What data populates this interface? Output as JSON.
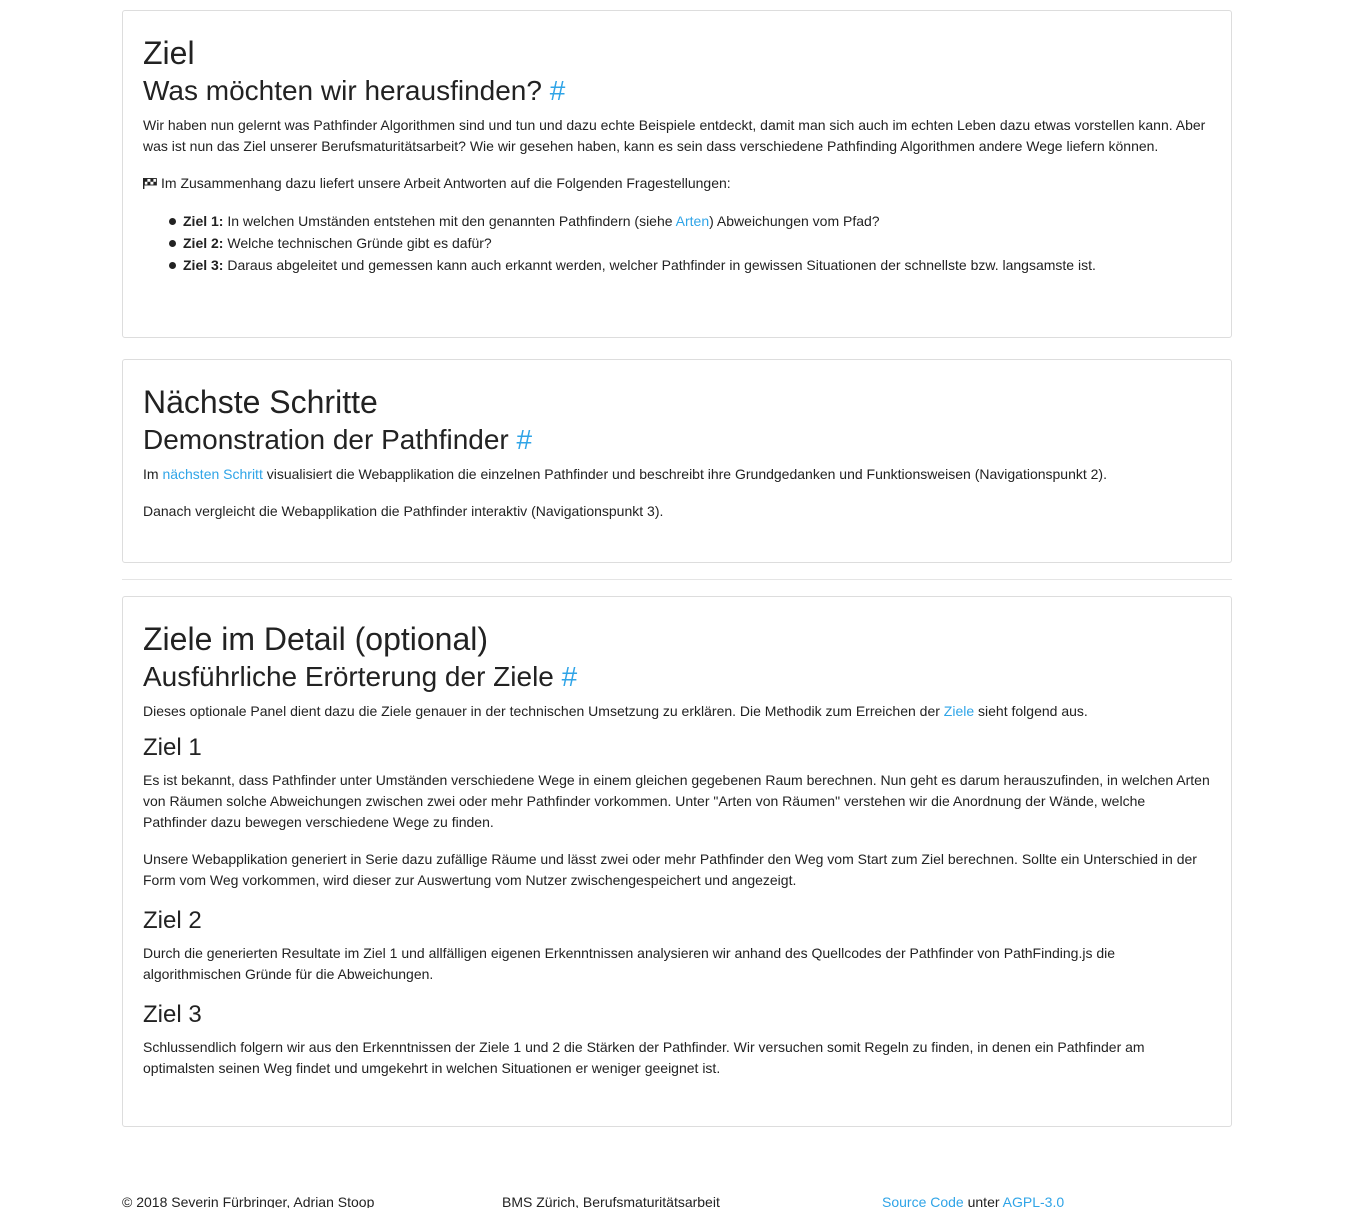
{
  "panel_goal": {
    "title": "Ziel",
    "subtitle": "Was möchten wir herausfinden?",
    "anchor": "#",
    "intro": "Wir haben nun gelernt was Pathfinder Algorithmen sind und tun und dazu echte Beispiele entdeckt, damit man sich auch im echten Leben dazu etwas vorstellen kann. Aber was ist nun das Ziel unserer Berufsmaturitätsarbeit? Wie wir gesehen haben, kann es sein dass verschiedene Pathfinding Algorithmen andere Wege liefern können.",
    "questions_intro": "Im Zusammenhang dazu liefert unsere Arbeit Antworten auf die Folgenden Fragestellungen:",
    "goals": [
      {
        "label": "Ziel 1:",
        "text_before": " In welchen Umständen entstehen mit den genannten Pathfindern (siehe ",
        "link": "Arten",
        "text_after": ") Abweichungen vom Pfad?"
      },
      {
        "label": "Ziel 2:",
        "text": " Welche technischen Gründe gibt es dafür?"
      },
      {
        "label": "Ziel 3:",
        "text": " Daraus abgeleitet und gemessen kann auch erkannt werden, welcher Pathfinder in gewissen Situationen der schnellste bzw. langsamste ist."
      }
    ]
  },
  "panel_next": {
    "title": "Nächste Schritte",
    "subtitle": "Demonstration der Pathfinder",
    "anchor": "#",
    "p1_before": "Im ",
    "p1_link": "nächsten Schritt",
    "p1_after": " visualisiert die Webapplikation die einzelnen Pathfinder und beschreibt ihre Grundgedanken und Funktionsweisen (Navigationspunkt 2).",
    "p2": "Danach vergleicht die Webapplikation die Pathfinder interaktiv (Navigationspunkt 3)."
  },
  "panel_detail": {
    "title": "Ziele im Detail (optional)",
    "subtitle": "Ausführliche Erörterung der Ziele",
    "anchor": "#",
    "intro_before": "Dieses optionale Panel dient dazu die Ziele genauer in der technischen Umsetzung zu erklären. Die Methodik zum Erreichen der ",
    "intro_link": "Ziele",
    "intro_after": " sieht folgend aus.",
    "goal1_title": "Ziel 1",
    "goal1_p1": "Es ist bekannt, dass Pathfinder unter Umständen verschiedene Wege in einem gleichen gegebenen Raum berechnen. Nun geht es darum herauszufinden, in welchen Arten von Räumen solche Abweichungen zwischen zwei oder mehr Pathfinder vorkommen. Unter \"Arten von Räumen\" verstehen wir die Anordnung der Wände, welche Pathfinder dazu bewegen verschiedene Wege zu finden.",
    "goal1_p2": "Unsere Webapplikation generiert in Serie dazu zufällige Räume und lässt zwei oder mehr Pathfinder den Weg vom Start zum Ziel berechnen. Sollte ein Unterschied in der Form vom Weg vorkommen, wird dieser zur Auswertung vom Nutzer zwischengespeichert und angezeigt.",
    "goal2_title": "Ziel 2",
    "goal2_p1": "Durch die generierten Resultate im Ziel 1 und allfälligen eigenen Erkenntnissen analysieren wir anhand des Quellcodes der Pathfinder von PathFinding.js die algorithmischen Gründe für die Abweichungen.",
    "goal3_title": "Ziel 3",
    "goal3_p1": "Schlussendlich folgern wir aus den Erkenntnissen der Ziele 1 und 2 die Stärken der Pathfinder. Wir versuchen somit Regeln zu finden, in denen ein Pathfinder am optimalsten seinen Weg findet und umgekehrt in welchen Situationen er weniger geeignet ist."
  },
  "footer": {
    "copyright": "© 2018 Severin Fürbringer, Adrian Stoop",
    "school": "BMS Zürich, Berufsmaturitätsarbeit",
    "source_link": "Source Code",
    "under": " unter ",
    "license_link": "AGPL-3.0"
  },
  "colors": {
    "link": "#2fa4e7",
    "text": "#222222",
    "border": "#dddddd"
  },
  "icons": {
    "flag": "checkered-flag-icon"
  }
}
